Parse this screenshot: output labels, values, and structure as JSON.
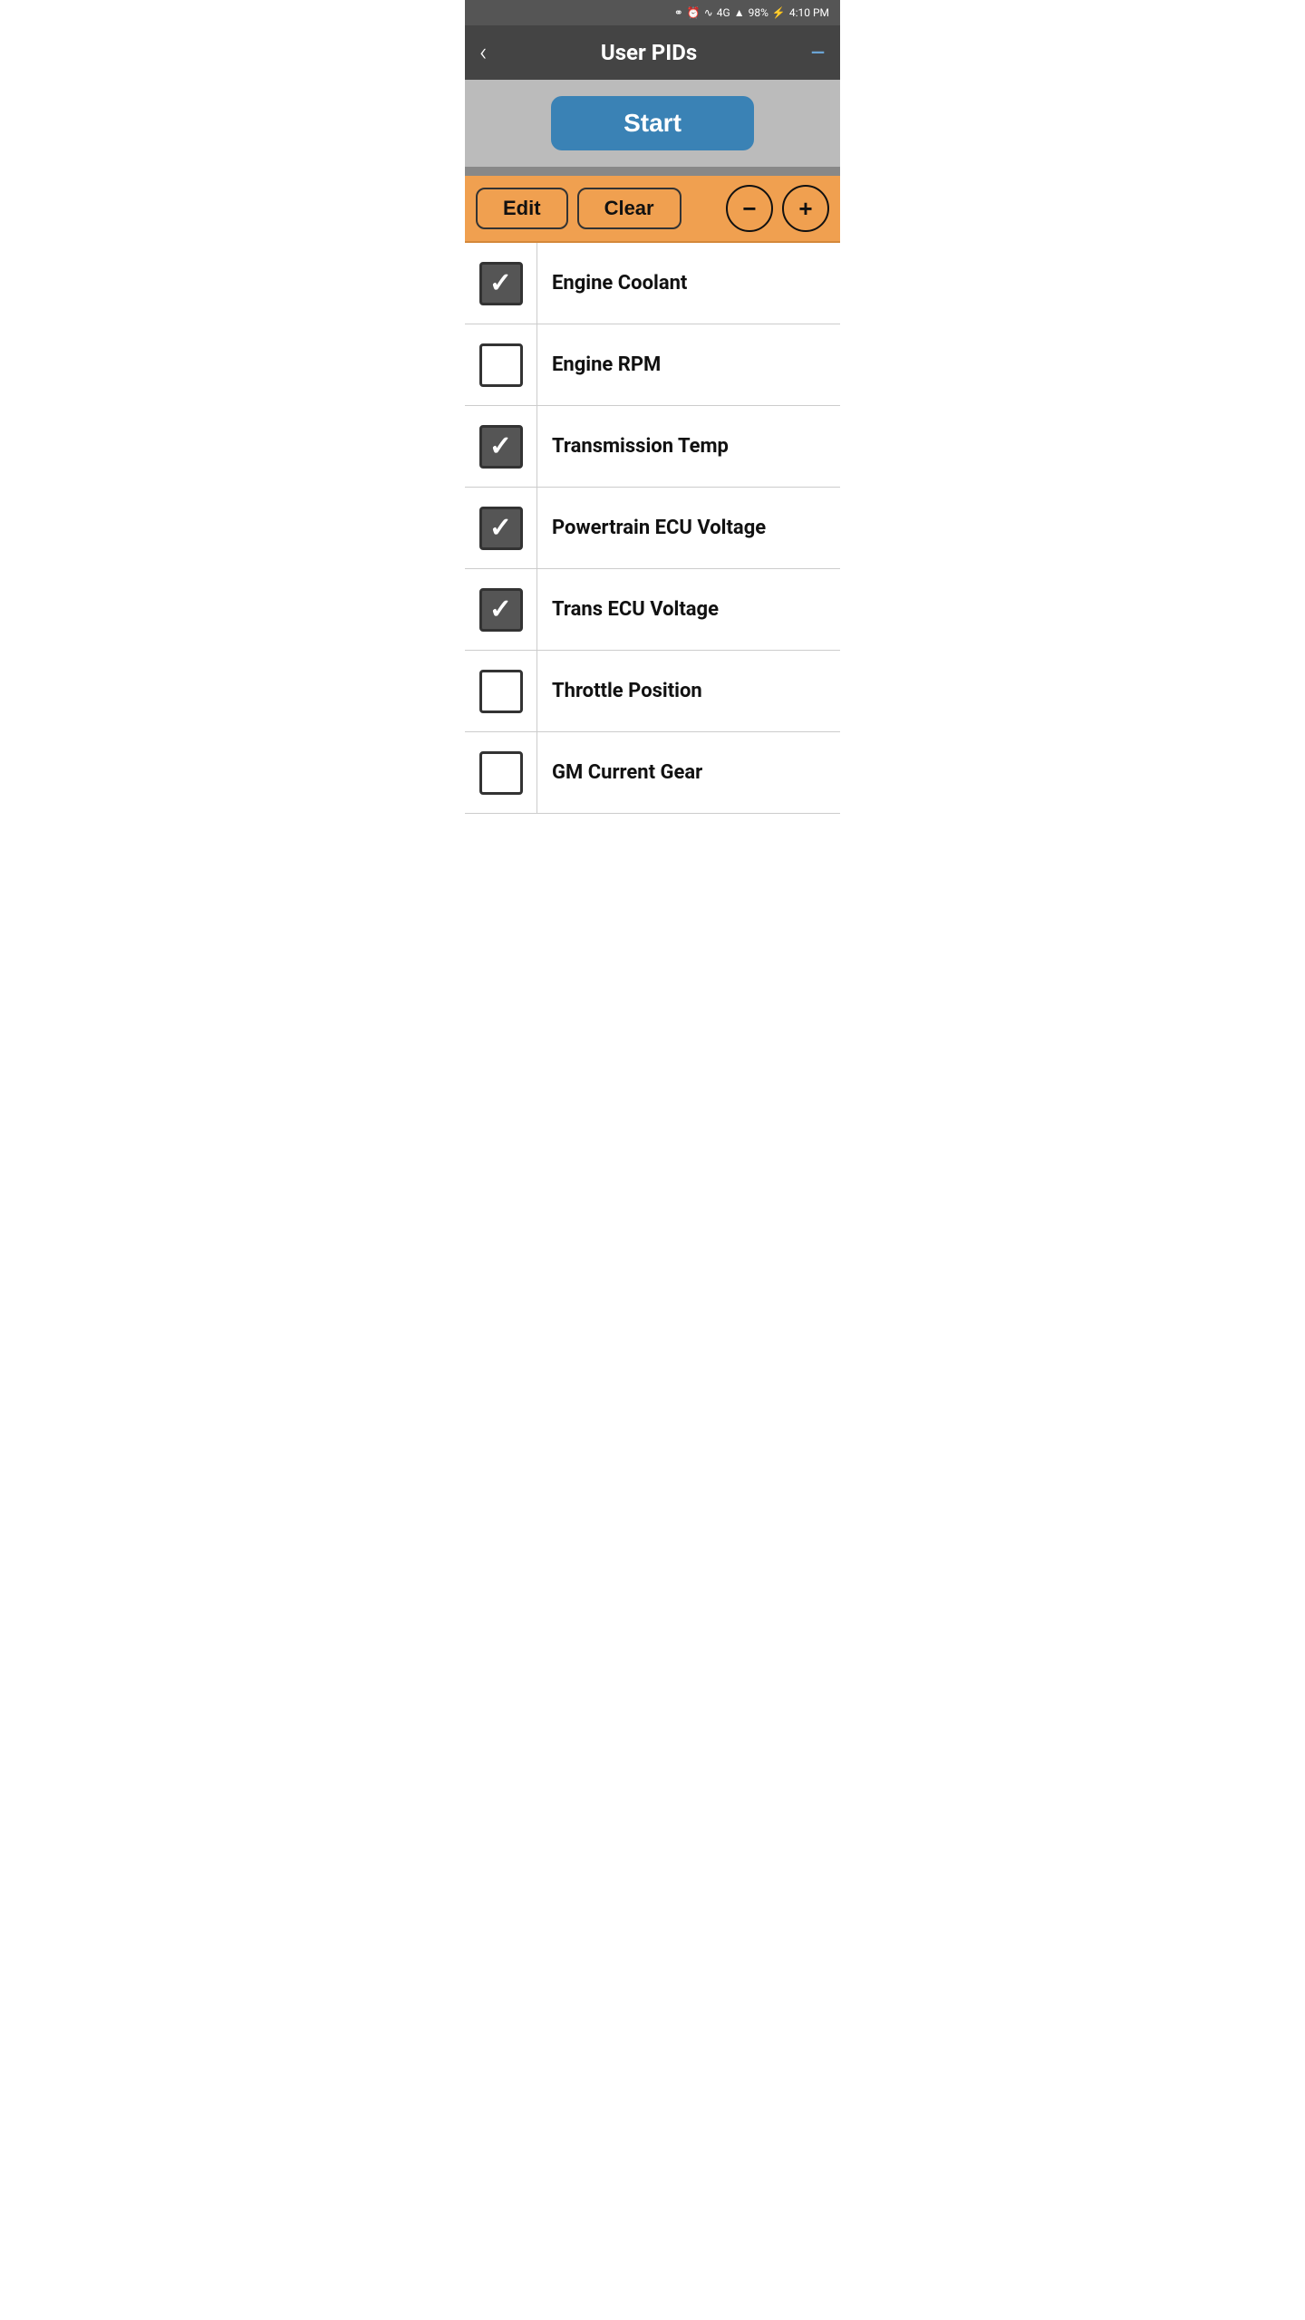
{
  "statusBar": {
    "battery": "98%",
    "time": "4:10 PM",
    "icons": [
      "bluetooth",
      "alarm",
      "wifi",
      "4g",
      "signal",
      "battery-charging"
    ]
  },
  "header": {
    "title": "User PIDs",
    "backLabel": "‹",
    "menuLabel": "—"
  },
  "startButton": {
    "label": "Start"
  },
  "toolbar": {
    "editLabel": "Edit",
    "clearLabel": "Clear",
    "decreaseLabel": "−",
    "increaseLabel": "+"
  },
  "pidItems": [
    {
      "id": 1,
      "label": "Engine Coolant",
      "checked": true
    },
    {
      "id": 2,
      "label": "Engine RPM",
      "checked": false
    },
    {
      "id": 3,
      "label": "Transmission Temp",
      "checked": true
    },
    {
      "id": 4,
      "label": "Powertrain ECU Voltage",
      "checked": true
    },
    {
      "id": 5,
      "label": "Trans ECU Voltage",
      "checked": true
    },
    {
      "id": 6,
      "label": "Throttle Position",
      "checked": false
    },
    {
      "id": 7,
      "label": "GM Current Gear",
      "checked": false
    }
  ]
}
